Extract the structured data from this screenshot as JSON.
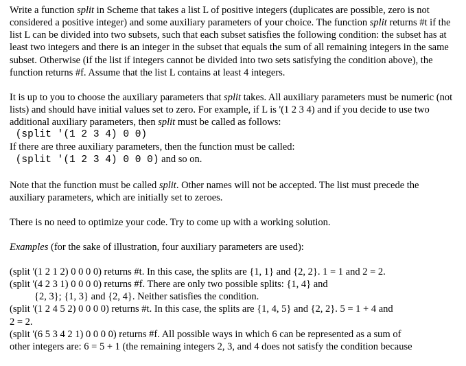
{
  "p1_a": "Write a function ",
  "p1_fn1": "split",
  "p1_b": " in Scheme that takes a list L of positive integers (duplicates are possible, zero is not considered a positive integer) and some auxiliary parameters of your choice. The function ",
  "p1_fn2": "split",
  "p1_c": " returns #t if the list L can be divided into two subsets, such that each subset satisfies the following condition: the subset has at least two integers and there is an integer in the subset that equals the sum of all remaining integers in the same subset. Otherwise (if the list if integers cannot be divided into two sets satisfying the condition above), the function returns #f. Assume that the list L contains at least 4 integers.",
  "p2_a": "It is up to you to choose the auxiliary parameters that ",
  "p2_fn1": "split",
  "p2_b": " takes. All auxiliary parameters must be numeric (not lists) and should have initial values set to zero. For example, if L is '(1 2 3 4) and if you decide to use two additional auxiliary parameters, then ",
  "p2_fn2": "split",
  "p2_c": " must be called as follows:",
  "code1": " (split '(1 2 3 4) 0 0)",
  "p2_d": "If there are three auxiliary parameters, then the function must be called:",
  "code2": " (split '(1 2 3 4) 0 0 0)",
  "code2_tail": "  and so on.",
  "p3_a": "Note that the function must be called ",
  "p3_fn1": "split",
  "p3_b": ". Other names will not be accepted. The list must precede the auxiliary parameters, which are initially set to zeroes.",
  "p4": "There is no need to optimize your code. Try to come up with a working solution.",
  "p5_a": "Examples",
  "p5_b": " (for the sake of illustration, four auxiliary parameters are used):",
  "ex1": "(split '(1 2 1 2) 0 0 0 0) returns #t. In this case, the splits are {1, 1} and {2, 2}. 1  = 1 and 2 = 2.",
  "ex2": "(split '(4 2 3 1) 0 0 0 0) returns #f. There are only two possible splits: {1, 4} and",
  "ex2b": "{2, 3}; {1, 3} and {2, 4}. Neither satisfies the condition.",
  "ex3a": "(split '(1 2 4 5 2) 0 0 0 0) returns #t. In this case, the splits are {1, 4, 5} and {2,  2}. 5 = 1 + 4 and",
  "ex3b": "2 = 2.",
  "ex4a": "(split '(6 5 3 4 2 1) 0 0 0 0) returns #f. All possible ways in which 6 can be represented as a sum of",
  "ex4b": "other integers are: 6 = 5 + 1 (the remaining integers 2, 3, and 4 does not satisfy the condition because"
}
